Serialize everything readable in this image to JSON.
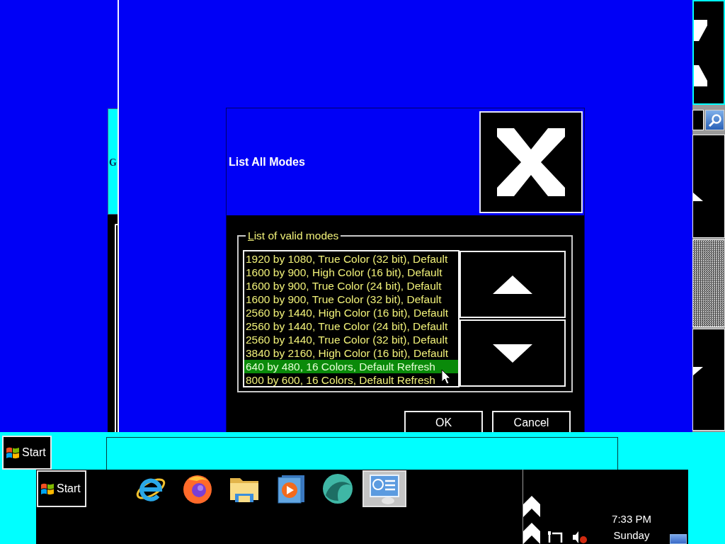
{
  "background_window": {
    "title": "G"
  },
  "dialog": {
    "title": "List All Modes",
    "group_label": "List of valid modes",
    "modes": [
      {
        "label": "1920 by 1080, True Color (32 bit), Default",
        "selected": false
      },
      {
        "label": "1600 by 900, High Color (16 bit), Default",
        "selected": false
      },
      {
        "label": "1600 by 900, True Color (24 bit), Default",
        "selected": false
      },
      {
        "label": "1600 by 900, True Color (32 bit), Default",
        "selected": false
      },
      {
        "label": "2560 by 1440, High Color (16 bit), Default",
        "selected": false
      },
      {
        "label": "2560 by 1440, True Color (24 bit), Default",
        "selected": false
      },
      {
        "label": "2560 by 1440, True Color (32 bit), Default",
        "selected": false
      },
      {
        "label": "3840 by 2160, High Color (16 bit), Default",
        "selected": false
      },
      {
        "label": "640 by 480, 16 Colors, Default Refresh",
        "selected": true
      },
      {
        "label": "800 by 600, 16 Colors, Default Refresh",
        "selected": false
      }
    ],
    "buttons": [
      {
        "label": "OK"
      },
      {
        "label": "Cancel"
      }
    ]
  },
  "desktop_start_button": {
    "label": "Start"
  },
  "taskbar": {
    "start_button": {
      "label": "Start"
    },
    "pinned": [
      {
        "kind": "web",
        "selected": false
      },
      {
        "kind": "fox",
        "selected": false
      },
      {
        "kind": "folder",
        "selected": false
      },
      {
        "kind": "player",
        "selected": false
      },
      {
        "kind": "globe",
        "selected": false
      },
      {
        "kind": "display",
        "selected": true
      }
    ],
    "clock": {
      "time": "7:33 PM",
      "day": "Sunday"
    }
  }
}
